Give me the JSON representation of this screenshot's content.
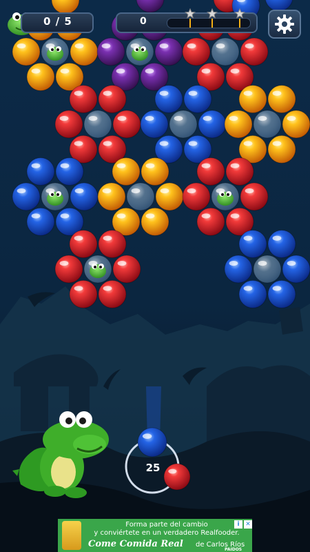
{
  "hud": {
    "counter": "0 / 5",
    "score": "0",
    "progress_fraction": 0.0,
    "stars_count": 3,
    "shots_remaining": "25"
  },
  "icons": {
    "mascot": "dinosaur-mascot-icon",
    "settings": "gear-icon",
    "star": "star-icon",
    "ad_info": "info-icon",
    "ad_close": "close-icon"
  },
  "colors": {
    "red": "#e3202a",
    "yellow": "#f5b014",
    "purple": "#6a2a9a",
    "blue": "#1e57d8",
    "dino_green": "#3fae2a",
    "sky_top": "#0c2a48",
    "sky_bottom": "#081220"
  },
  "board": {
    "flowers": [
      {
        "color": "yellow",
        "center": "dino"
      },
      {
        "color": "purple",
        "center": "dino"
      },
      {
        "color": "red",
        "center": "empty"
      },
      {
        "color": "red",
        "center": "empty"
      },
      {
        "color": "blue",
        "center": "empty"
      },
      {
        "color": "yellow",
        "center": "empty"
      },
      {
        "color": "blue",
        "center": "dino"
      },
      {
        "color": "yellow",
        "center": "empty"
      },
      {
        "color": "red",
        "center": "dino"
      },
      {
        "color": "red",
        "center": "dino"
      },
      {
        "color": "blue",
        "center": "empty"
      }
    ],
    "shooter": {
      "current": "blue",
      "next": "red"
    }
  },
  "ad": {
    "line1": "Forma parte del cambio",
    "line2": "y conviértete en un verdadero Realfooder.",
    "brand": "Come Comida Real",
    "tagline": "de Carlos Ríos",
    "mark": "PAIDOS"
  }
}
